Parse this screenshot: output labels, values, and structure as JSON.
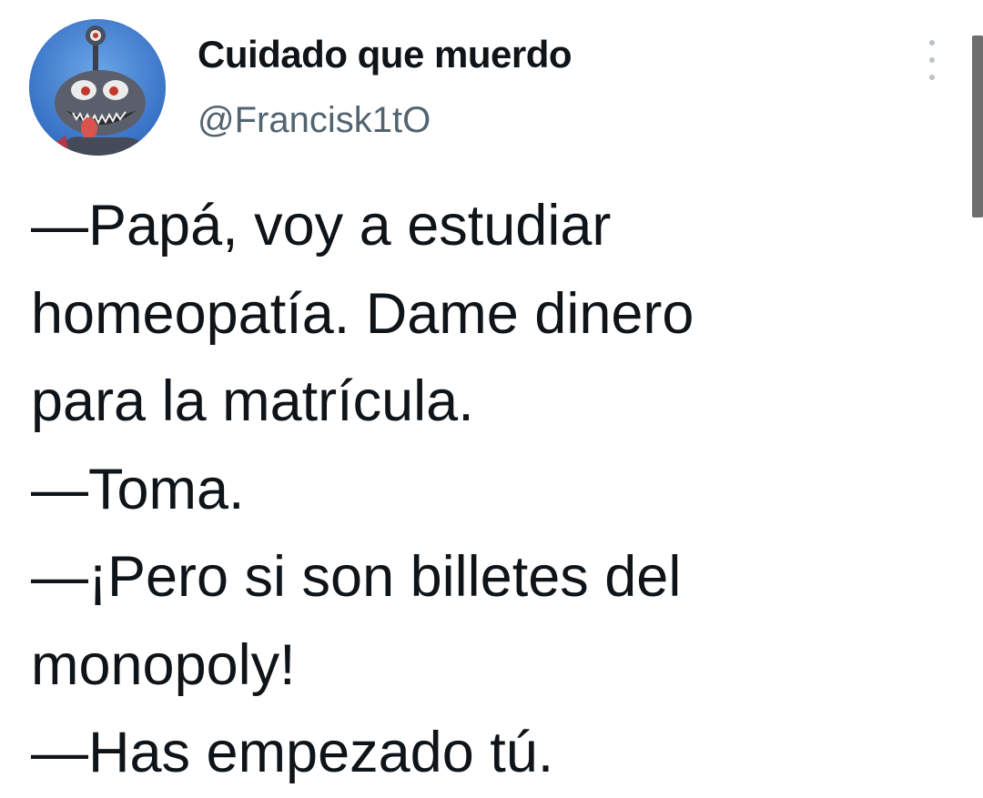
{
  "tweet": {
    "author": {
      "display_name": "Cuidado que muerdo",
      "handle": "@Francisk1tO",
      "avatar_icon": "cartoon-creature-avatar"
    },
    "more_icon": "vertical-ellipsis-icon",
    "text_lines": [
      "—Papá, voy a estudiar",
      "homeopatía. Dame dinero",
      "para la matrícula.",
      "—Toma.",
      "—¡Pero si son billetes del",
      "monopoly!",
      "—Has empezado tú."
    ]
  },
  "colors": {
    "text": "#0f1419",
    "secondary_text": "#536471",
    "avatar_background": "#3f7fd0",
    "scrollbar": "#6e6e6e"
  }
}
